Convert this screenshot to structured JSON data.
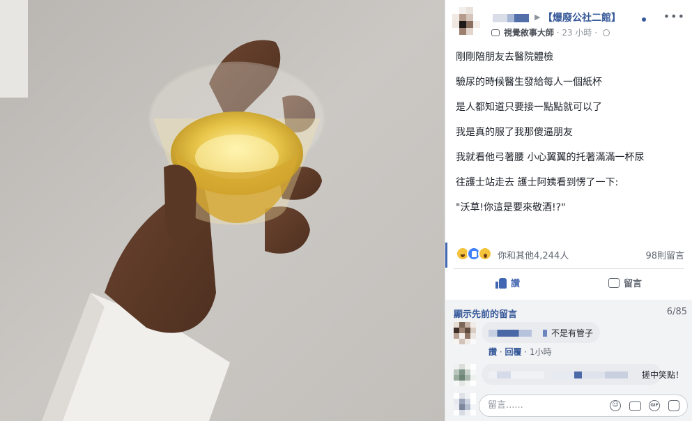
{
  "post": {
    "group_arrow": "▶",
    "group_name": "【爆廢公社二館】",
    "more": "•••",
    "badge": "視覺敘事大師",
    "time": "23 小時",
    "separator": "·",
    "lines": [
      "剛剛陪朋友去醫院體檢",
      "驗尿的時候醫生發給每人一個紙杯",
      "是人都知道只要接一點點就可以了",
      "我是真的服了我那傻逼朋友",
      "我就看他弓著腰 小心翼翼的托著滿滿一杯尿",
      "往護士站走去 護士阿姨看到愣了一下:",
      "\"沃草!你這是要來敬酒!?\""
    ],
    "reactions_text": "你和其他4,244人",
    "comments_text": "98則留言",
    "like_label": "讚",
    "comment_label": "留言"
  },
  "comments": {
    "show_previous": "顯示先前的留言",
    "pager": "6/85",
    "items": [
      {
        "text": "不是有管子",
        "like": "讚",
        "reply": "回覆",
        "time": "1小時"
      },
      {
        "text": "搓中笑點！"
      }
    ],
    "input_placeholder": "留言......"
  },
  "icons": [
    "play-arrow-icon",
    "more-icon",
    "badge-icon",
    "globe-icon",
    "haha-reaction-icon",
    "like-reaction-icon",
    "wow-reaction-icon",
    "thumbs-up-icon",
    "comment-bubble-icon",
    "emoji-icon",
    "camera-icon",
    "gif-icon",
    "sticker-icon"
  ],
  "colors": {
    "link": "#365899",
    "accent": "#4267b2",
    "muted": "#606770"
  }
}
